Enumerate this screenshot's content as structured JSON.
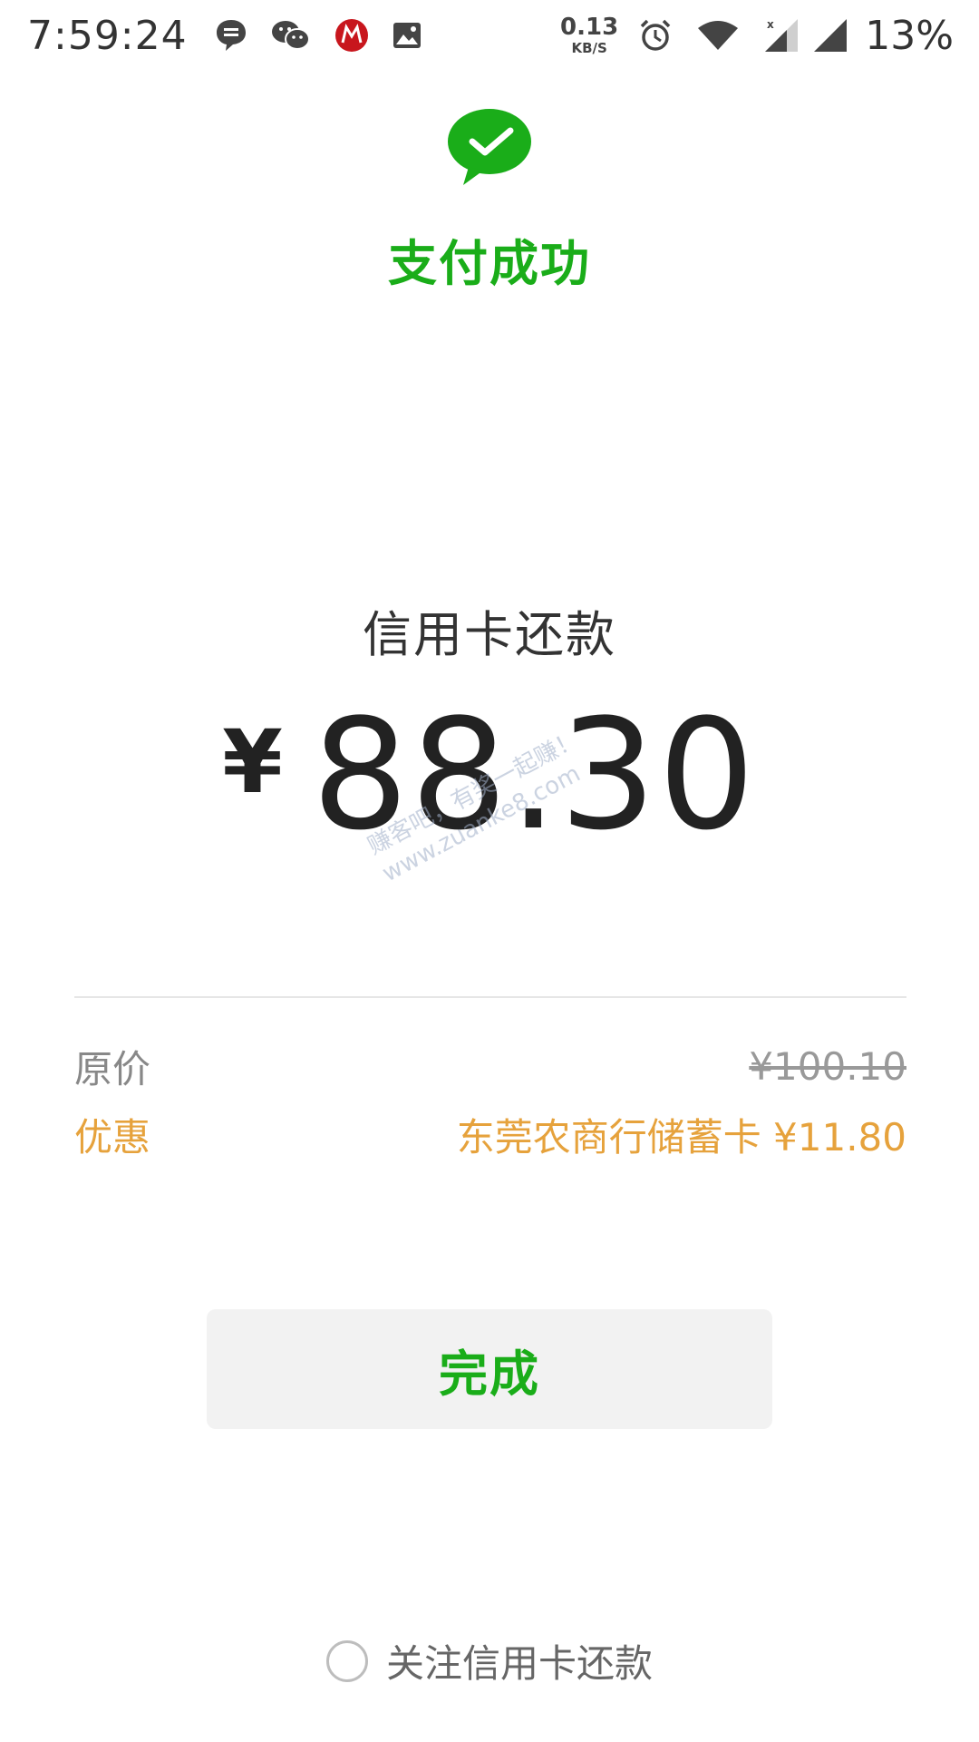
{
  "status_bar": {
    "time": "7:59:24",
    "net_speed_value": "0.13",
    "net_speed_unit": "KB/S",
    "battery": "13%",
    "icons": [
      "message-icon",
      "wechat-icon",
      "bank-app-icon",
      "gallery-icon",
      "alarm-icon",
      "wifi-icon",
      "signal-icon",
      "signal-icon"
    ]
  },
  "header": {
    "title": "支付成功",
    "accent_color": "#1aad19"
  },
  "payment": {
    "merchant": "信用卡还款",
    "currency": "¥",
    "amount": "88.30"
  },
  "watermark": {
    "line1": "赚客吧，有奖一起赚！",
    "line2": "www.zuanke8.com"
  },
  "details": {
    "original_label": "原价",
    "original_value": "¥100.10",
    "discount_label": "优惠",
    "discount_value": "东莞农商行储蓄卡 ¥11.80",
    "discount_color": "#e6a23c"
  },
  "actions": {
    "done_label": "完成"
  },
  "follow": {
    "label": "关注信用卡还款",
    "checked": false
  }
}
